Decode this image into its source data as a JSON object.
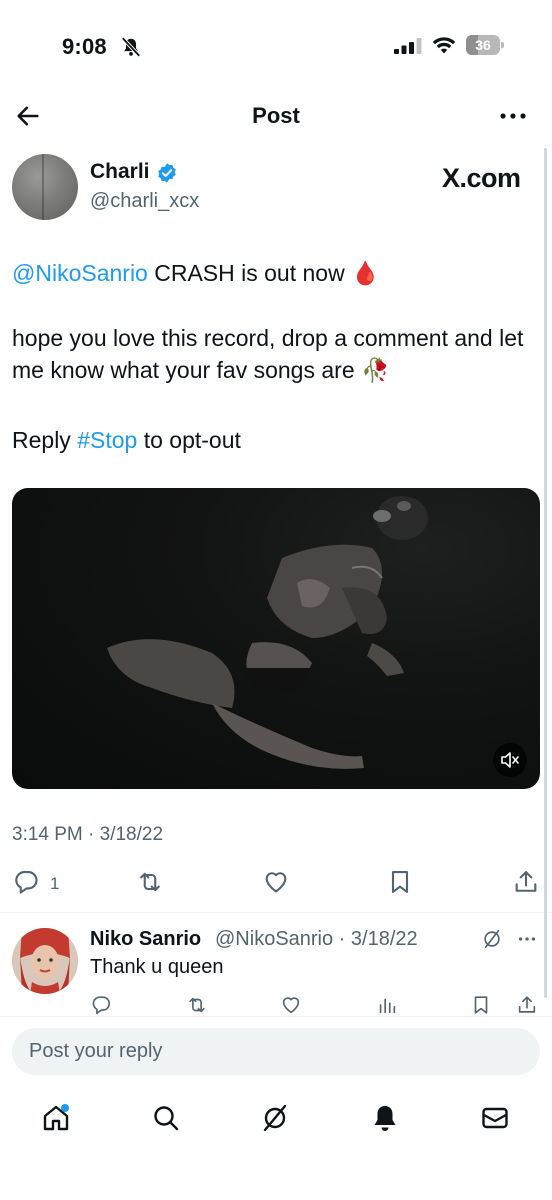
{
  "status_bar": {
    "time": "9:08",
    "battery": "36",
    "battery_level": 0.36
  },
  "header": {
    "title": "Post"
  },
  "post": {
    "author": {
      "name": "Charli",
      "handle": "@charli_xcx"
    },
    "badge": "X.com",
    "text": {
      "line1_mention": "@NikoSanrio",
      "line1_rest": " CRASH is out now 🩸",
      "line2": "hope you love this record, drop a comment and let me know what your fav songs are 🥀",
      "line3_prefix": "Reply ",
      "line3_hashtag": "#Stop",
      "line3_suffix": " to opt-out"
    },
    "timestamp": "3:14 PM · 3/18/22",
    "actions": {
      "reply_count": "1"
    }
  },
  "reply": {
    "name": "Niko Sanrio",
    "meta": "@NikoSanrio · 3/18/22",
    "text": "Thank u queen"
  },
  "composer": {
    "placeholder": "Post your reply"
  },
  "icons": {
    "back": "arrow-left-icon",
    "more": "more-horizontal-icon",
    "verified": "verified-badge-icon",
    "mute": "volume-muted-icon",
    "reply": "reply-icon",
    "repost": "repost-icon",
    "like": "heart-icon",
    "bookmark": "bookmark-icon",
    "share": "share-icon",
    "views": "views-icon",
    "grok": "grok-icon",
    "home": "home-icon",
    "search": "search-icon",
    "notifications": "bell-icon",
    "messages": "mail-icon"
  },
  "colors": {
    "accent": "#1d9bf0",
    "text": "#0f1419",
    "secondary": "#536471"
  }
}
